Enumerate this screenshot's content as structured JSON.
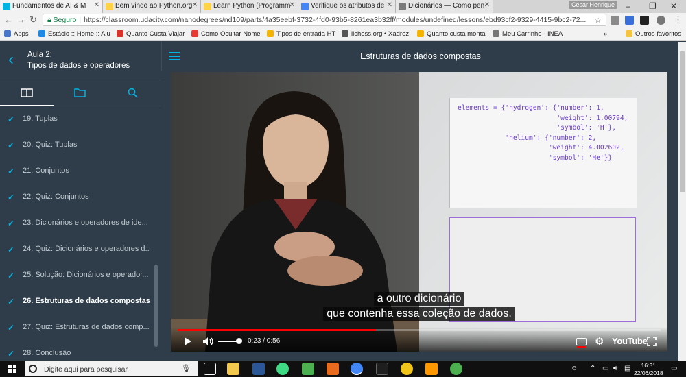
{
  "browser": {
    "tabs": [
      {
        "title": "Fundamentos de AI & M",
        "favicon_color": "#02b3e4",
        "active": true
      },
      {
        "title": "Bem vindo ao Python.org",
        "favicon_color": "#ffd343",
        "active": false
      },
      {
        "title": "Learn Python (Programm",
        "favicon_color": "#ffd343",
        "active": false
      },
      {
        "title": "Verifique os atributos de",
        "favicon_color": "#4285f4",
        "active": false
      },
      {
        "title": "Dicionários — Como pen",
        "favicon_color": "#7a7a7a",
        "active": false
      }
    ],
    "profile_name": "Cesar Henrique",
    "security_label": "Seguro",
    "url": "https://classroom.udacity.com/nanodegrees/nd109/parts/4a35eebf-3732-4fd0-93b5-8261ea3b32ff/modules/undefined/lessons/ebd93cf2-9329-4415-9bc2-72...",
    "bookmarks": [
      {
        "label": "Apps",
        "color": "#4a75c9"
      },
      {
        "label": "Estácio :: Home :: Alu",
        "color": "#1e88e5"
      },
      {
        "label": "Quanto Custa Viajar",
        "color": "#d9342b"
      },
      {
        "label": "Como Ocultar Nome",
        "color": "#e53935"
      },
      {
        "label": "Tipos de entrada HT",
        "color": "#f4b400"
      },
      {
        "label": "lichess.org • Xadrez",
        "color": "#555555"
      },
      {
        "label": "Quanto custa monta",
        "color": "#f4b400"
      },
      {
        "label": "Meu Carrinho - INEA",
        "color": "#777777"
      }
    ],
    "bookmarks_more": "»",
    "other_bookmarks": "Outros favoritos"
  },
  "sidebar": {
    "lesson_number": "Aula 2:",
    "lesson_title": "Tipos de dados e operadores",
    "concepts": [
      {
        "title": "19. Tuplas",
        "current": false
      },
      {
        "title": "20. Quiz: Tuplas",
        "current": false
      },
      {
        "title": "21. Conjuntos",
        "current": false
      },
      {
        "title": "22. Quiz: Conjuntos",
        "current": false
      },
      {
        "title": "23. Dicionários e operadores de ide...",
        "current": false
      },
      {
        "title": "24. Quiz: Dicionários e operadores d...",
        "current": false
      },
      {
        "title": "25. Solução: Dicionários e operador...",
        "current": false
      },
      {
        "title": "26. Estruturas de dados compostas",
        "current": true
      },
      {
        "title": "27. Quiz: Estruturas de dados comp...",
        "current": false
      },
      {
        "title": "28. Conclusão",
        "current": false
      }
    ]
  },
  "main": {
    "page_title": "Estruturas de dados compostas"
  },
  "video": {
    "code_lines": [
      "elements = {'hydrogen': {'number': 1,",
      "                         'weight': 1.00794,",
      "                         'symbol': 'H'},",
      "            'helium': {'number': 2,",
      "                       'weight': 4.002602,",
      "                       'symbol': 'He'}}"
    ],
    "caption_line1": "a outro dicionário",
    "caption_line2": "que contenha essa coleção de dados.",
    "time_display": "0:23 / 0:56",
    "progress_fraction": 0.41,
    "player_brand": "YouTube"
  },
  "taskbar": {
    "search_placeholder": "Digite aqui para pesquisar",
    "time": "16:31",
    "date": "22/06/2018"
  }
}
